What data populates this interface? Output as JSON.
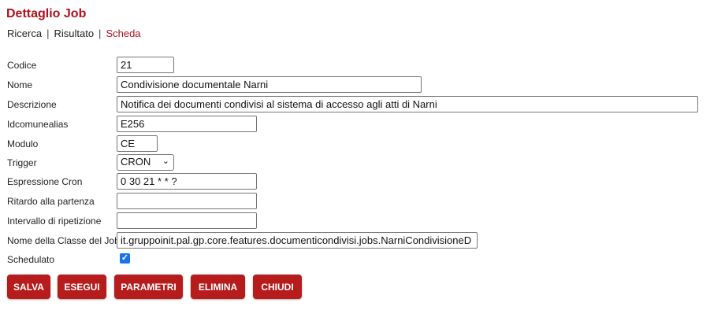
{
  "page": {
    "title": "Dettaglio Job"
  },
  "breadcrumb": {
    "items": [
      "Ricerca",
      "Risultato",
      "Scheda"
    ],
    "separator": "|"
  },
  "form": {
    "codice": {
      "label": "Codice",
      "value": "21"
    },
    "nome": {
      "label": "Nome",
      "value": "Condivisione documentale Narni"
    },
    "descrizione": {
      "label": "Descrizione",
      "value": "Notifica dei documenti condivisi al sistema di accesso agli atti di Narni"
    },
    "idcomunealias": {
      "label": "Idcomunealias",
      "value": "E256"
    },
    "modulo": {
      "label": "Modulo",
      "value": "CE"
    },
    "trigger": {
      "label": "Trigger",
      "value": "CRON"
    },
    "espressione_cron": {
      "label": "Espressione Cron",
      "value": "0 30 21 * * ?"
    },
    "ritardo": {
      "label": "Ritardo alla partenza",
      "value": ""
    },
    "intervallo": {
      "label": "Intervallo di ripetizione",
      "value": ""
    },
    "classe": {
      "label": "Nome della Classe del Job",
      "value": "it.gruppoinit.pal.gp.core.features.documenticondivisi.jobs.NarniCondivisioneD"
    },
    "schedulato": {
      "label": "Schedulato",
      "checked": true
    }
  },
  "buttons": {
    "salva": "SALVA",
    "esegui": "ESEGUI",
    "parametri": "PARAMETRI",
    "elimina": "ELIMINA",
    "chiudi": "CHIUDI"
  },
  "colors": {
    "accent": "#b0101c",
    "button_bg": "#b71c1c",
    "checkbox": "#1a73e8"
  }
}
